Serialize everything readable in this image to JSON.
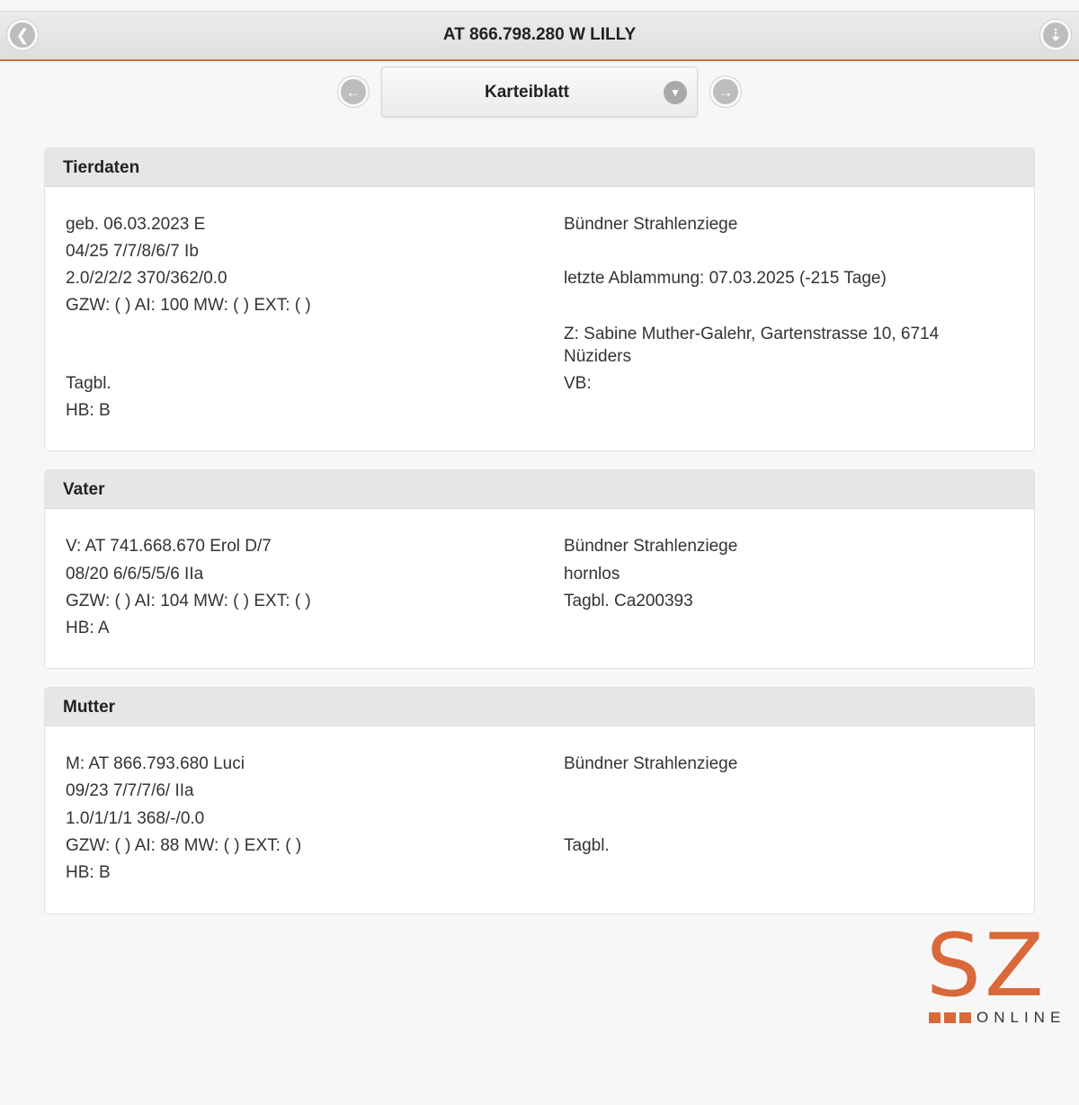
{
  "header": {
    "title": "AT 866.798.280 W LILLY",
    "back_icon": "chevron-left-icon",
    "download_icon": "download-icon"
  },
  "nav": {
    "selected": "Karteiblatt",
    "prev_icon": "arrow-left-icon",
    "next_icon": "arrow-right-icon",
    "dropdown_icon": "chevron-down-icon"
  },
  "tierdaten": {
    "heading": "Tierdaten",
    "left": [
      "geb. 06.03.2023 E",
      "04/25 7/7/8/6/7 Ib",
      "2.0/2/2/2 370/362/0.0",
      "GZW: ( ) AI: 100 MW: ( ) EXT: ( )",
      "Tagbl.",
      "HB: B"
    ],
    "right": [
      "Bündner Strahlenziege",
      "letzte Ablammung: 07.03.2025 (-215 Tage)",
      "Z: Sabine Muther-Galehr, Gartenstrasse 10, 6714 Nüziders",
      "VB:"
    ]
  },
  "vater": {
    "heading": "Vater",
    "left": [
      "V: AT 741.668.670 Erol D/7",
      "08/20 6/6/5/5/6 IIa",
      "GZW: ( ) AI: 104 MW: ( ) EXT: ( )",
      "HB: A"
    ],
    "right": [
      "Bündner Strahlenziege",
      "hornlos",
      "Tagbl. Ca200393"
    ]
  },
  "mutter": {
    "heading": "Mutter",
    "left": [
      "M: AT 866.793.680 Luci",
      "09/23 7/7/7/6/ IIa",
      "1.0/1/1/1 368/-/0.0",
      "GZW: ( ) AI: 88 MW: ( ) EXT: ( )",
      "HB: B"
    ],
    "right": [
      "Bündner Strahlenziege",
      "Tagbl."
    ]
  },
  "logo": {
    "letters": "SZ",
    "subtitle": "ONLINE",
    "color": "#d9683a"
  },
  "colors": {
    "accent": "#c8703a",
    "panel_header": "#e6e6e6",
    "button": "#bdbdbd"
  }
}
